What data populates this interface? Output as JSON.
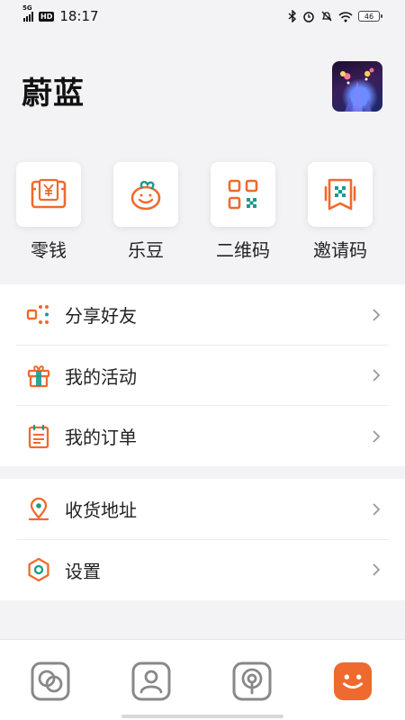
{
  "status_bar": {
    "network": "5G",
    "hd": "HD",
    "time": "18:17",
    "battery": "46"
  },
  "profile": {
    "username": "蔚蓝"
  },
  "quick_actions": [
    {
      "label": "零钱",
      "icon": "wallet-yen-icon"
    },
    {
      "label": "乐豆",
      "icon": "bean-mascot-icon"
    },
    {
      "label": "二维码",
      "icon": "qr-code-icon"
    },
    {
      "label": "邀请码",
      "icon": "invite-code-icon"
    }
  ],
  "menu_group_1": [
    {
      "label": "分享好友",
      "icon": "share-icon"
    },
    {
      "label": "我的活动",
      "icon": "gift-icon"
    },
    {
      "label": "我的订单",
      "icon": "order-list-icon"
    }
  ],
  "menu_group_2": [
    {
      "label": "收货地址",
      "icon": "location-pin-icon"
    },
    {
      "label": "设置",
      "icon": "settings-icon"
    }
  ],
  "tabbar": {
    "tabs": [
      "circles-tab-icon",
      "person-tab-icon",
      "podcast-tab-icon",
      "smile-tab-icon"
    ],
    "active_index": 3
  },
  "colors": {
    "accent": "#ef6a2e",
    "teal": "#179b8f",
    "tab_inactive": "#888888"
  }
}
